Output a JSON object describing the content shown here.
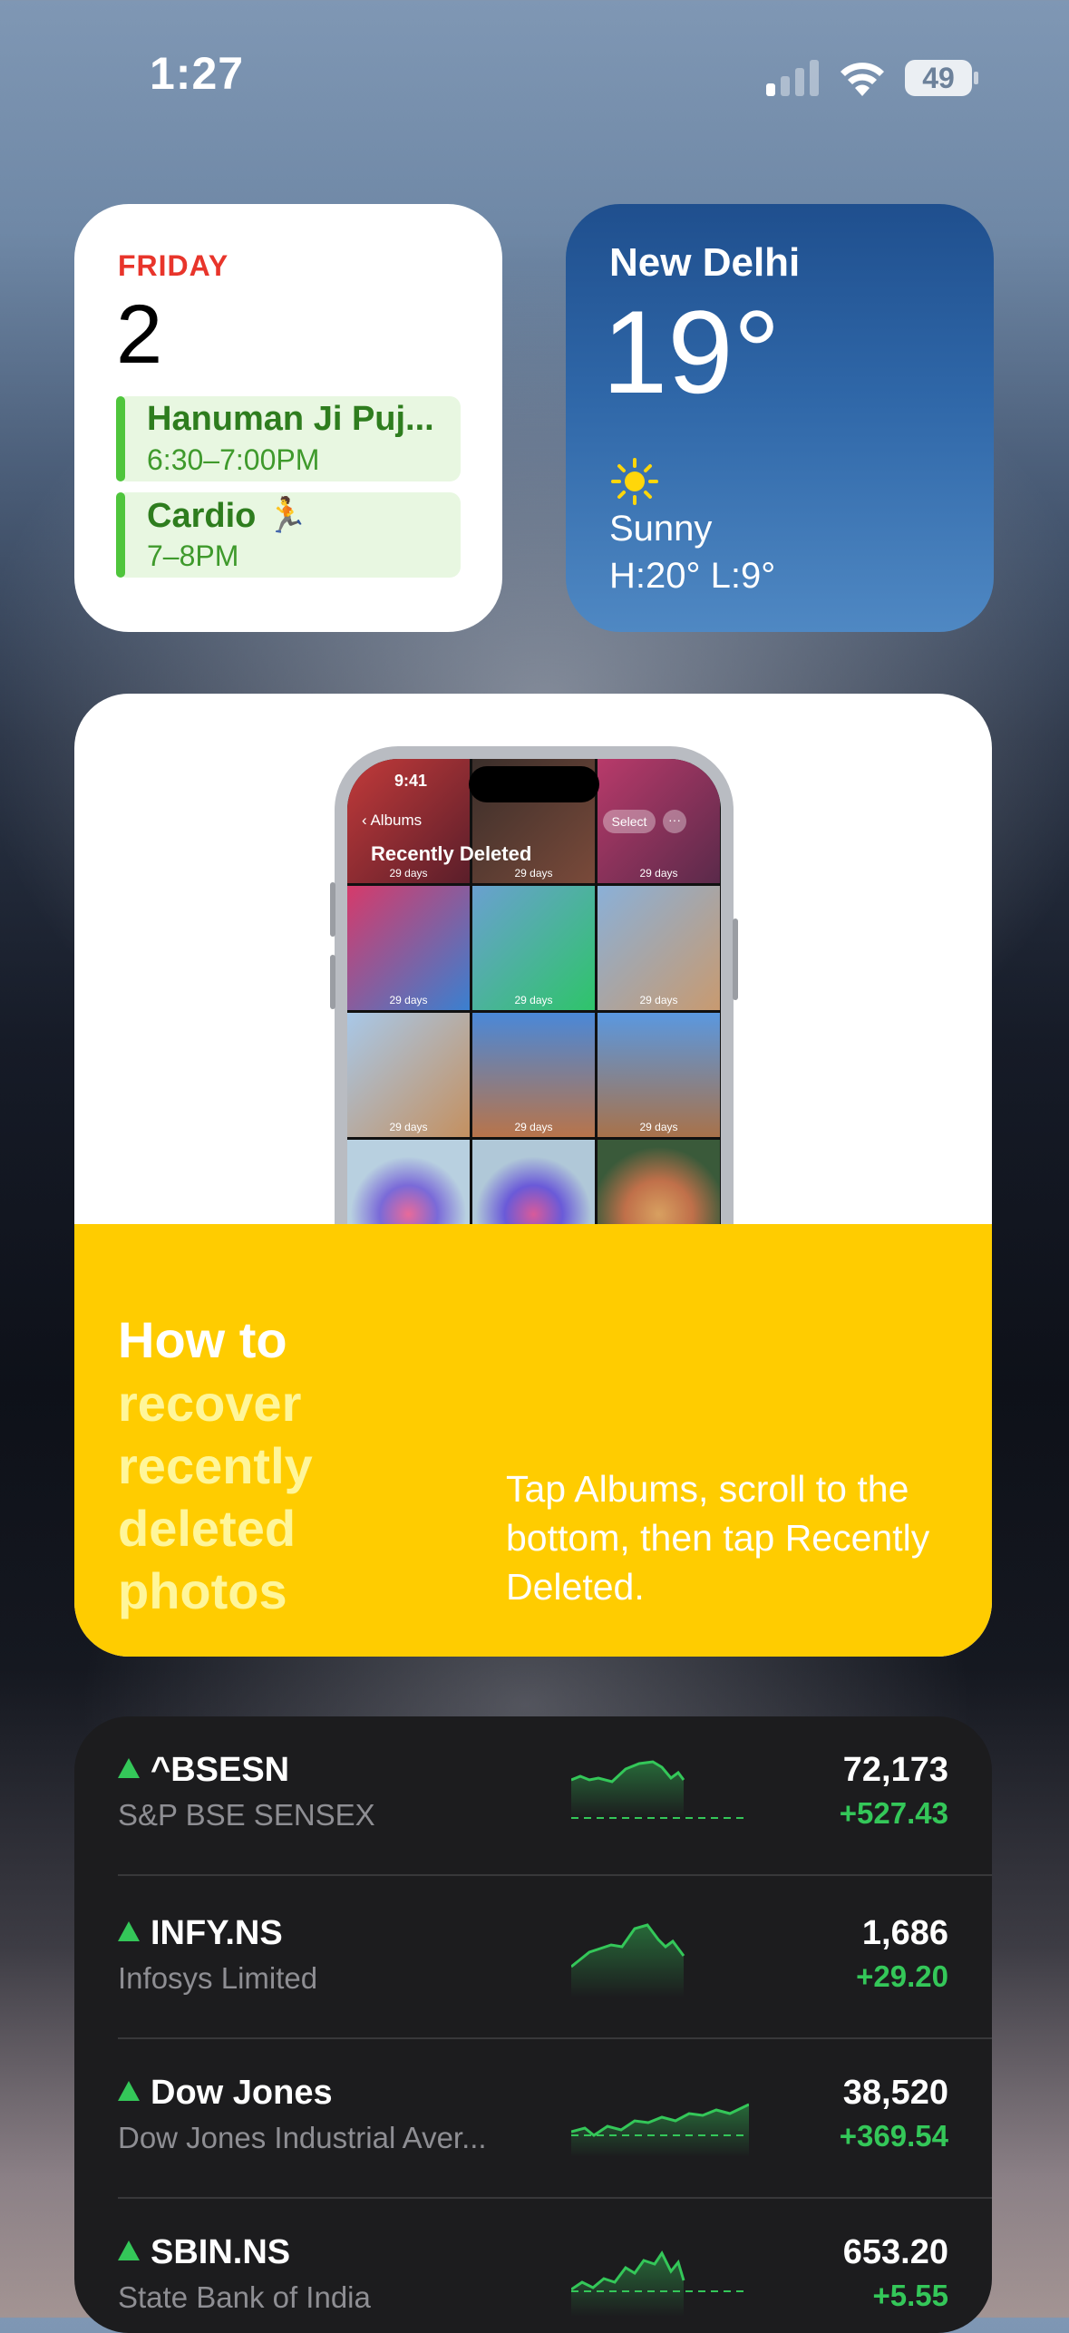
{
  "status_bar": {
    "time": "1:27",
    "battery": "49"
  },
  "calendar": {
    "weekday": "FRIDAY",
    "date": "2",
    "events": [
      {
        "title": "Hanuman Ji Puj...",
        "time": "6:30–7:00PM"
      },
      {
        "title": "Cardio 🏃",
        "time": "7–8PM"
      }
    ]
  },
  "weather": {
    "city": "New Delhi",
    "temperature": "19°",
    "icon": "sun-icon",
    "condition": "Sunny",
    "high_low": "H:20° L:9°"
  },
  "tips": {
    "phone": {
      "time": "9:41",
      "back_label": "Albums",
      "select_label": "Select",
      "more_label": "···",
      "title": "Recently Deleted",
      "cell_caption": "29 days"
    },
    "heading_1": "How to",
    "heading_2": "recover recently deleted photos",
    "description": "Tap Albums, scroll to the bottom, then tap Recently Deleted.",
    "accent_color": "#ffcc00"
  },
  "stocks": [
    {
      "symbol": "^BSESN",
      "name": "S&P BSE SENSEX",
      "price": "72,173",
      "change": "+527.43",
      "trend": "up"
    },
    {
      "symbol": "INFY.NS",
      "name": "Infosys Limited",
      "price": "1,686",
      "change": "+29.20",
      "trend": "up"
    },
    {
      "symbol": "Dow Jones",
      "name": "Dow Jones Industrial Aver...",
      "price": "38,520",
      "change": "+369.54",
      "trend": "up"
    },
    {
      "symbol": "SBIN.NS",
      "name": "State Bank of India",
      "price": "653.20",
      "change": "+5.55",
      "trend": "up"
    }
  ]
}
